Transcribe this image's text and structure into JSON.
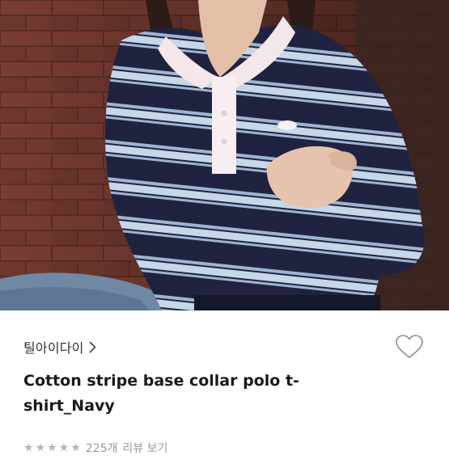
{
  "product": {
    "brand_name": "틸아이다이",
    "title_line1": "Cotton stripe base collar polo t-",
    "title_line2": "shirt_Navy",
    "rating_stars": 5,
    "review_count": "225개",
    "review_link": "리뷰 보기"
  },
  "icons": {
    "brand_chevron": "chevron-right-icon",
    "wishlist": "heart-outline-icon",
    "star": "star-icon"
  },
  "colors": {
    "stripe_navy": "#1f2340",
    "stripe_light": "#b9cbe0",
    "collar": "#f3e7ea",
    "text_primary": "#1a1a1a",
    "text_muted": "#9a9a9a"
  }
}
